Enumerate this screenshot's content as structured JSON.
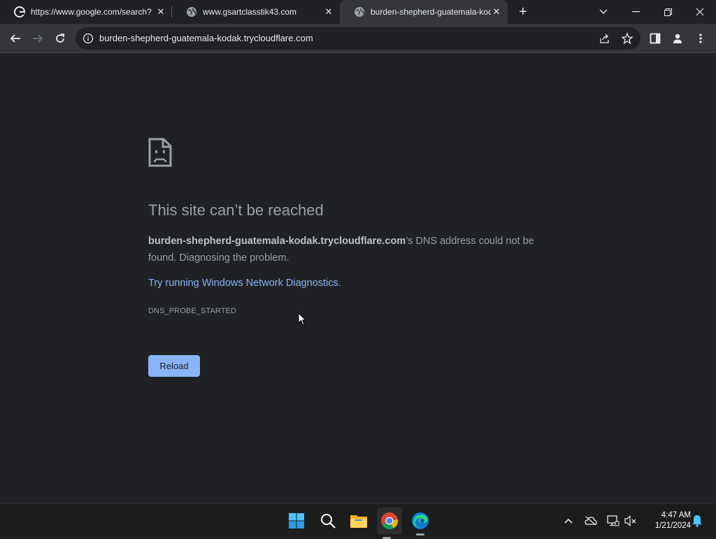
{
  "tabs": [
    {
      "title": "https://www.google.com/search?",
      "icon": "google-icon",
      "close": "✕"
    },
    {
      "title": "www.gsartclasstik43.com",
      "icon": "globe-icon",
      "close": "✕"
    },
    {
      "title": "burden-shepherd-guatemala-kodak",
      "icon": "globe-icon",
      "close": "✕",
      "active": true
    }
  ],
  "new_tab": "+",
  "toolbar": {
    "url": "burden-shepherd-guatemala-kodak.trycloudflare.com"
  },
  "error": {
    "headline": "This site can’t be reached",
    "host": "burden-shepherd-guatemala-kodak.trycloudflare.com",
    "message": "’s DNS address could not be found. Diagnosing the problem.",
    "link": "Try running Windows Network Diagnostics",
    "link_suffix": ".",
    "code": "DNS_PROBE_STARTED",
    "reload_label": "Reload"
  },
  "taskbar": {
    "time": "4:47 AM",
    "date": "1/21/2024"
  },
  "colors": {
    "accent": "#8ab4f8",
    "background": "#202124",
    "toolbar": "#35363a"
  }
}
